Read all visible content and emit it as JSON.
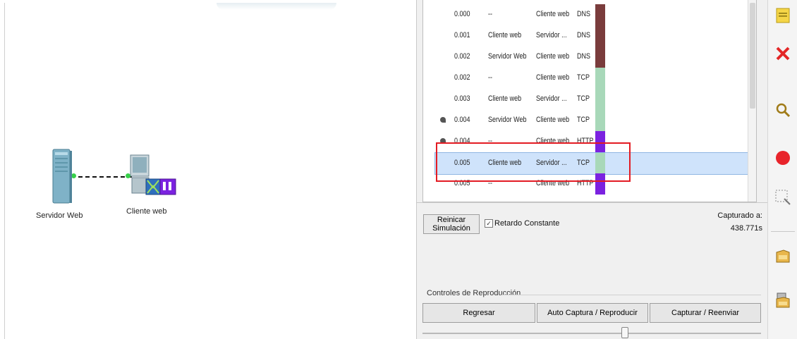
{
  "workspace": {
    "devices": [
      {
        "label": "Servidor Web",
        "icon": "server-icon"
      },
      {
        "label": "Cliente web",
        "icon": "pc-icon"
      }
    ]
  },
  "events": {
    "rows": [
      {
        "time": "0.000",
        "last_device": "--",
        "at_device": "Cliente web",
        "type": "DNS",
        "color": "#7a3c3c",
        "eye": false,
        "selected": false
      },
      {
        "time": "0.001",
        "last_device": "Cliente web",
        "at_device": "Servidor ...",
        "type": "DNS",
        "color": "#7a3c3c",
        "eye": false,
        "selected": false
      },
      {
        "time": "0.002",
        "last_device": "Servidor Web",
        "at_device": "Cliente web",
        "type": "DNS",
        "color": "#7a3c3c",
        "eye": false,
        "selected": false
      },
      {
        "time": "0.002",
        "last_device": "--",
        "at_device": "Cliente web",
        "type": "TCP",
        "color": "#a8d8b9",
        "eye": false,
        "selected": false
      },
      {
        "time": "0.003",
        "last_device": "Cliente web",
        "at_device": "Servidor ...",
        "type": "TCP",
        "color": "#a8d8b9",
        "eye": false,
        "selected": false
      },
      {
        "time": "0.004",
        "last_device": "Servidor Web",
        "at_device": "Cliente web",
        "type": "TCP",
        "color": "#a8d8b9",
        "eye": true,
        "selected": false
      },
      {
        "time": "0.004",
        "last_device": "--",
        "at_device": "Cliente web",
        "type": "HTTP",
        "color": "#7b22e0",
        "eye": true,
        "selected": false
      },
      {
        "time": "0.005",
        "last_device": "Cliente web",
        "at_device": "Servidor ...",
        "type": "TCP",
        "color": "#a8d8b9",
        "eye": false,
        "selected": true
      },
      {
        "time": "0.005",
        "last_device": "--",
        "at_device": "Cliente web",
        "type": "HTTP",
        "color": "#7b22e0",
        "eye": false,
        "selected": false
      }
    ]
  },
  "controls": {
    "reset_label": "Reinicar Simulación",
    "constant_delay_label": "Retardo Constante",
    "constant_delay_checked": true,
    "captured_label": "Capturado a:",
    "captured_value": "438.771s"
  },
  "playback": {
    "section_label": "Controles de Reproducción",
    "back_label": "Regresar",
    "auto_label": "Auto Captura / Reproducir",
    "capture_label": "Capturar / Reenviar"
  },
  "toolbar": {
    "tools": [
      "note-icon",
      "delete-icon",
      "inspect-icon",
      "record-icon",
      "resize-icon",
      "simple-pdu-icon",
      "complex-pdu-icon"
    ],
    "colors": {
      "delete": "#e32626",
      "record": "#e8242b",
      "note": "#f5d547"
    }
  }
}
